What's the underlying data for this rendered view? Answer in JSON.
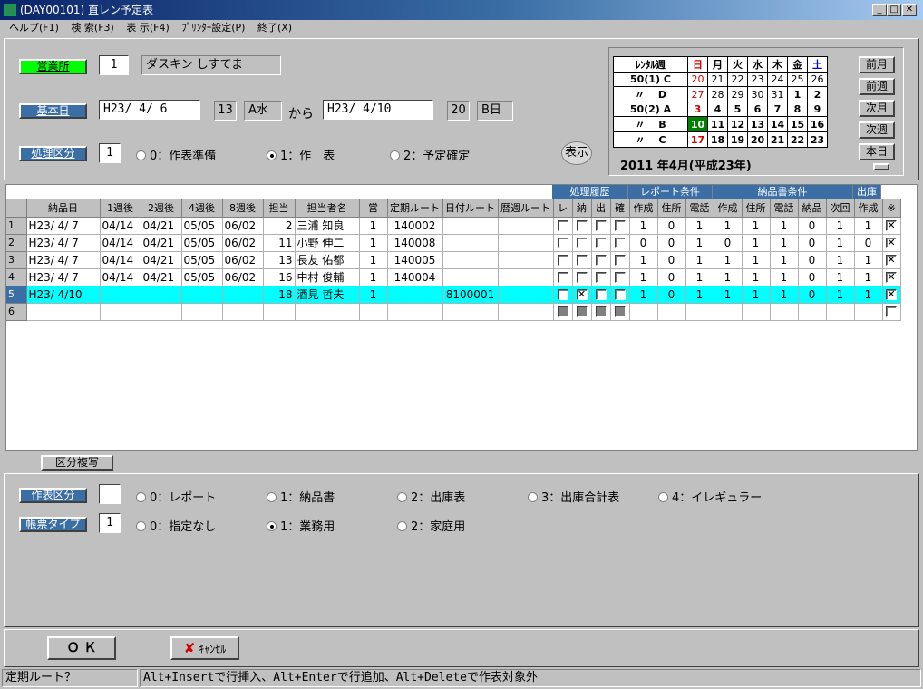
{
  "window": {
    "title": "(DAY00101) 直レン予定表"
  },
  "menu": [
    "ヘルプ(F1)",
    "検 索(F3)",
    "表 示(F4)",
    "ﾌﾟﾘﾝﾀｰ設定(P)",
    "終了(X)"
  ],
  "branch": {
    "label": "営業所",
    "code": "1",
    "name": "ダスキン しすてま"
  },
  "base_date": {
    "label": "基本日",
    "from": "H23/ 4/ 6",
    "from_num": "13",
    "from_wk": "A水",
    "kara": "から",
    "to": "H23/ 4/10",
    "to_num": "20",
    "to_wk": "B日"
  },
  "process": {
    "label": "処理区分",
    "value": "1",
    "options": [
      "0：作表準備",
      "1：作　表",
      "2：予定確定"
    ],
    "selected": 1,
    "show_button": "表示"
  },
  "calendar": {
    "caption": "2011 年4月(平成23年)",
    "header": [
      "ﾚﾝﾀﾙ週",
      "日",
      "月",
      "火",
      "水",
      "木",
      "金",
      "土"
    ],
    "rows": [
      {
        "wk": "50(1) C",
        "d": [
          "20",
          "21",
          "22",
          "23",
          "24",
          "25",
          "26"
        ]
      },
      {
        "wk": "〃　 D",
        "d": [
          "27",
          "28",
          "29",
          "30",
          "31",
          "1",
          "2"
        ]
      },
      {
        "wk": "50(2) A",
        "d": [
          "3",
          "4",
          "5",
          "6",
          "7",
          "8",
          "9"
        ]
      },
      {
        "wk": "〃　 B",
        "d": [
          "10",
          "11",
          "12",
          "13",
          "14",
          "15",
          "16"
        ]
      },
      {
        "wk": "〃　 C",
        "d": [
          "17",
          "18",
          "19",
          "20",
          "21",
          "22",
          "23"
        ]
      }
    ],
    "buttons": [
      "前月",
      "前週",
      "次月",
      "次週",
      "本日"
    ],
    "colors": {
      "sunday": "#d00000",
      "saturday": "#0000d0",
      "today_bg": "#008000"
    }
  },
  "grid": {
    "groups": [
      "処理履歴",
      "レポート条件",
      "納品書条件",
      "出庫"
    ],
    "headers": [
      "納品日",
      "1週後",
      "2週後",
      "4週後",
      "8週後",
      "担当",
      "担当者名",
      "営",
      "定期ルート",
      "日付ルート",
      "暦週ルート",
      "レ",
      "納",
      "出",
      "確",
      "作成",
      "住所",
      "電話",
      "作成",
      "住所",
      "電話",
      "納品",
      "次回",
      "作成",
      "※"
    ],
    "rows": [
      {
        "n": "1",
        "date": "H23/ 4/ 7",
        "w1": "04/14",
        "w2": "04/21",
        "w4": "05/05",
        "w8": "06/02",
        "tan": "2",
        "name": "三浦 知良",
        "ei": "1",
        "teiki": "140002",
        "hiduke": "",
        "reki": "",
        "chk": [
          0,
          0,
          0,
          0
        ],
        "vals": [
          "1",
          "0",
          "1",
          "1",
          "1",
          "1",
          "0",
          "1",
          "1"
        ],
        "x": 1
      },
      {
        "n": "2",
        "date": "H23/ 4/ 7",
        "w1": "04/14",
        "w2": "04/21",
        "w4": "05/05",
        "w8": "06/02",
        "tan": "11",
        "name": "小野 伸二",
        "ei": "1",
        "teiki": "140008",
        "hiduke": "",
        "reki": "",
        "chk": [
          0,
          0,
          0,
          0
        ],
        "vals": [
          "0",
          "0",
          "1",
          "0",
          "1",
          "1",
          "0",
          "1",
          "0"
        ],
        "x": 1
      },
      {
        "n": "3",
        "date": "H23/ 4/ 7",
        "w1": "04/14",
        "w2": "04/21",
        "w4": "05/05",
        "w8": "06/02",
        "tan": "13",
        "name": "長友 佑都",
        "ei": "1",
        "teiki": "140005",
        "hiduke": "",
        "reki": "",
        "chk": [
          0,
          0,
          0,
          0
        ],
        "vals": [
          "1",
          "0",
          "1",
          "1",
          "1",
          "1",
          "0",
          "1",
          "1"
        ],
        "x": 1
      },
      {
        "n": "4",
        "date": "H23/ 4/ 7",
        "w1": "04/14",
        "w2": "04/21",
        "w4": "05/05",
        "w8": "06/02",
        "tan": "16",
        "name": "中村 俊輔",
        "ei": "1",
        "teiki": "140004",
        "hiduke": "",
        "reki": "",
        "chk": [
          0,
          0,
          0,
          0
        ],
        "vals": [
          "1",
          "0",
          "1",
          "1",
          "1",
          "1",
          "0",
          "1",
          "1"
        ],
        "x": 1
      },
      {
        "n": "5",
        "date": "H23/ 4/10",
        "w1": "",
        "w2": "",
        "w4": "",
        "w8": "",
        "tan": "18",
        "name": "酒見 哲夫",
        "ei": "1",
        "teiki": "",
        "hiduke": "8100001",
        "reki": "",
        "chk": [
          0,
          1,
          0,
          0
        ],
        "vals": [
          "1",
          "0",
          "1",
          "1",
          "1",
          "1",
          "0",
          "1",
          "1"
        ],
        "x": 1,
        "selected": true
      },
      {
        "n": "6",
        "date": "",
        "w1": "",
        "w2": "",
        "w4": "",
        "w8": "",
        "tan": "",
        "name": "",
        "ei": "",
        "teiki": "",
        "hiduke": "",
        "reki": "",
        "chk": [
          2,
          2,
          2,
          2
        ],
        "vals": [
          "",
          "",
          "",
          "",
          "",
          "",
          "",
          "",
          ""
        ],
        "x": 0
      }
    ]
  },
  "copy_button": "区分複写",
  "work": {
    "label": "作表区分",
    "value": "",
    "options": [
      "0：レポート",
      "1：納品書",
      "2：出庫表",
      "3：出庫合計表",
      "4：イレギュラー"
    ]
  },
  "form_type": {
    "label": "帳票タイプ",
    "value": "1",
    "options": [
      "0：指定なし",
      "1：業務用",
      "2：家庭用"
    ],
    "selected": 1
  },
  "ok_button": "Ｏ Ｋ",
  "cancel_button": "ｷｬﾝｾﾙ",
  "status": {
    "left": "定期ルート？",
    "right": "Alt+Insertで行挿入、Alt+Enterで行追加、Alt+Deleteで作表対象外"
  }
}
